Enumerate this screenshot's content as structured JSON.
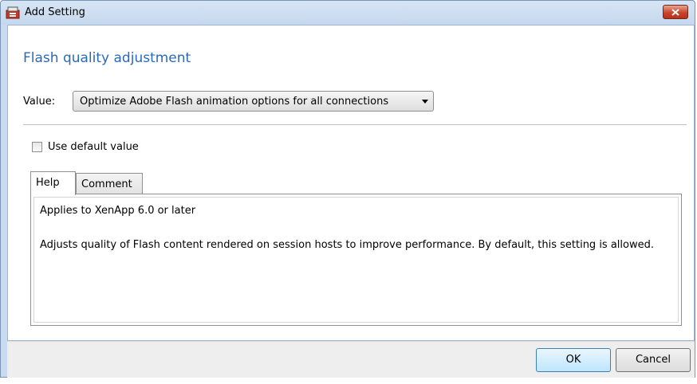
{
  "window": {
    "title": "Add Setting",
    "app_icon": "citrix-policy-icon",
    "close_icon": "close-icon"
  },
  "main": {
    "heading": "Flash quality adjustment",
    "value_label": "Value:",
    "value_selected": "Optimize Adobe Flash animation options for all connections",
    "use_default_label": "Use default value",
    "use_default_checked": false
  },
  "tabs": [
    {
      "label": "Help",
      "active": true
    },
    {
      "label": "Comment",
      "active": false
    }
  ],
  "help": {
    "applies_to": "Applies to XenApp 6.0 or later",
    "description": "Adjusts quality of Flash content rendered on session hosts to improve performance.  By default, this setting is allowed."
  },
  "footer": {
    "ok_label": "OK",
    "cancel_label": "Cancel"
  },
  "colors": {
    "heading": "#2a6ab8",
    "titlebar": "#c5d8ee",
    "close_button": "#c8452c"
  }
}
